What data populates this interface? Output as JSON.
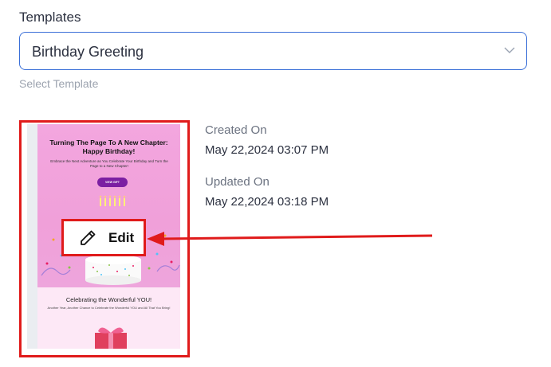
{
  "templates": {
    "label": "Templates",
    "selected": "Birthday Greeting",
    "helper": "Select Template"
  },
  "preview": {
    "headline": "Turning The Page To A New Chapter: Happy Birthday!",
    "subtext": "Embrace the Next Adventure as You Celebrate Your Birthday and Turn the Page to a New Chapter!",
    "button_text": "VIEW GIFT",
    "section_title": "Celebrating the Wonderful YOU!",
    "section_text": "Another Year, Another Chance to Celebrate the Wonderful YOU and All That You Bring!"
  },
  "edit": {
    "label": "Edit",
    "icon": "pencil-icon"
  },
  "meta": {
    "created_label": "Created On",
    "created_value": "May 22,2024 03:07 PM",
    "updated_label": "Updated On",
    "updated_value": "May 22,2024 03:18 PM"
  },
  "colors": {
    "accent_blue": "#3a6fd8",
    "highlight_red": "#e01b1b",
    "preview_pink": "#f0a0d9",
    "preview_button": "#7b1fa2"
  }
}
